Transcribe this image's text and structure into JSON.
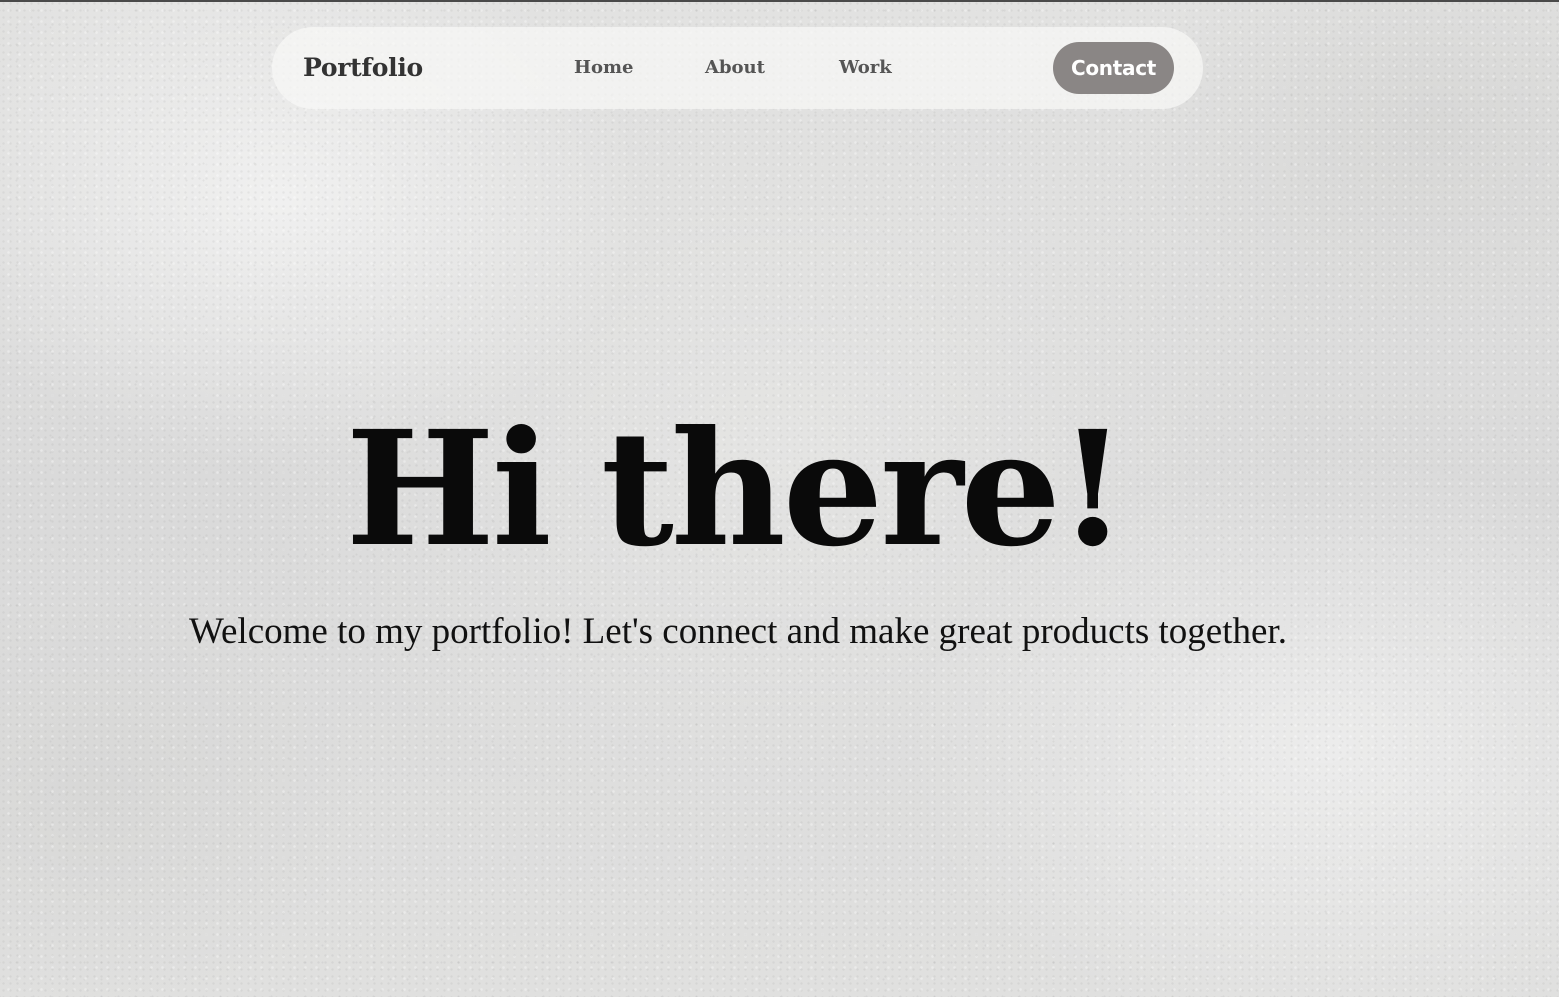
{
  "nav": {
    "brand": "Portfolio",
    "links": [
      {
        "label": "Home"
      },
      {
        "label": "About"
      },
      {
        "label": "Work"
      }
    ],
    "cta_label": "Contact"
  },
  "hero": {
    "title": "Hi there!",
    "subtitle": "Welcome to my portfolio! Let's connect and make great products together."
  },
  "colors": {
    "background": "#dcdcdb",
    "navbar_bg": "#f4f4f3",
    "cta_bg": "#8a8685",
    "cta_text": "#ffffff",
    "nav_text": "#555555",
    "brand_text": "#333333",
    "heading_text": "#0a0a0a"
  }
}
